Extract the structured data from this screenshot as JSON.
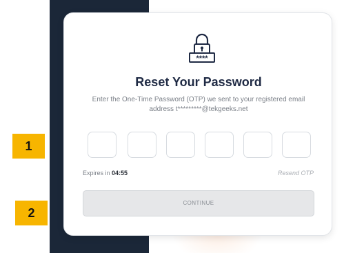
{
  "card": {
    "title": "Reset Your Password",
    "subtitle_line1": "Enter the One-Time Password (OTP) we sent to your registered email",
    "subtitle_line2": "address t*********@tekgeeks.net",
    "lock_icon": "lock-password-icon",
    "otp_masked": "****"
  },
  "otp": {
    "digits": [
      "",
      "",
      "",
      "",
      "",
      ""
    ]
  },
  "timer": {
    "label": "Expires in",
    "value": "04:55"
  },
  "resend_label": "Resend OTP",
  "continue_label": "CONTINUE",
  "annotations": {
    "badge_1": "1",
    "badge_2": "2",
    "color": "#f7b500"
  },
  "colors": {
    "dark_panel": "#1b2738",
    "title": "#1f2a44",
    "button_bg": "#e6e7e9"
  }
}
